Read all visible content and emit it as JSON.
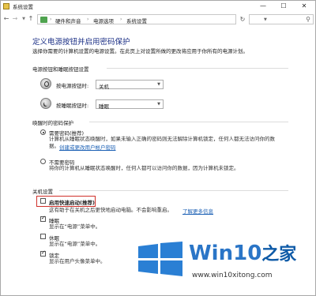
{
  "window": {
    "title": "系统设置",
    "controls": {
      "minimize": "—",
      "maximize": "☐",
      "close": "✕"
    }
  },
  "navigation": {
    "breadcrumbs": [
      "硬件和声音",
      "电源选项",
      "系统设置"
    ],
    "separator": "›",
    "refresh": "↻",
    "search_icon": "search-icon"
  },
  "page": {
    "title": "定义电源按钮并启用密码保护",
    "description": "选择你需要的计算机设置的电源设置。在此页上对设置所做的更改将应用于你所有的电源计划。"
  },
  "buttons_group": {
    "title": "电源按钮和睡眠按钮设置",
    "rows": [
      {
        "label": "按电源按钮时:",
        "value": "关机",
        "icon": "power-icon"
      },
      {
        "label": "按睡眠按钮时:",
        "value": "睡眠",
        "icon": "sleep-icon"
      }
    ]
  },
  "password_group": {
    "title": "唤醒时的密码保护",
    "options": [
      {
        "label": "需要密码(推荐)",
        "checked": true,
        "desc": [
          "计算机从睡眠状态唤醒时，如果未输入正确的密码则无法解除计算机锁定，任何人都无法访问你的数",
          "据。"
        ],
        "link": "创建或更改用户帐户密码"
      },
      {
        "label": "不需要密码",
        "checked": false,
        "desc": [
          "将你的计算机从睡眠状态唤醒时，任何人都可以访问你的数据，因为计算机未锁定。"
        ]
      }
    ]
  },
  "shutdown_group": {
    "title": "关机设置",
    "fast_startup": {
      "label": "启用快速启动(推荐)",
      "checked": false,
      "desc": "这有助于在关机之后更快地启动电脑。不会影响重启。",
      "link": "了解更多信息"
    },
    "items": [
      {
        "label": "睡眠",
        "checked": true,
        "desc": "显示在“电源”菜单中。"
      },
      {
        "label": "休眠",
        "checked": false,
        "desc": "显示在“电源”菜单中。"
      },
      {
        "label": "锁定",
        "checked": true,
        "desc": "显示在用户头像菜单中。"
      }
    ]
  },
  "watermark": {
    "brand": "Win10",
    "brand_suffix": "之家",
    "url": "www.win10xitong.com",
    "colors": {
      "logo": "#2a7fd4",
      "text": "#2a75c7"
    }
  }
}
